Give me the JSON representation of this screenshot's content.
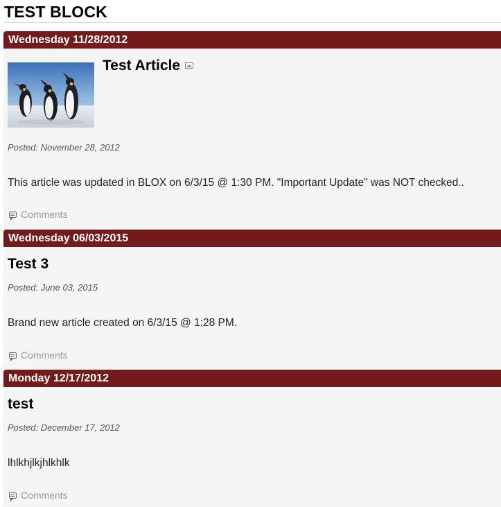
{
  "block": {
    "title": "TEST BLOCK"
  },
  "articles": [
    {
      "date": "Wednesday 11/28/2012",
      "title": "Test Article",
      "has_image": true,
      "image_icon": "image-icon",
      "posted": "Posted: November 28, 2012",
      "body": "This article was updated in BLOX on 6/3/15 @ 1:30 PM. \"Important Update\" was NOT checked..",
      "comments_label": "Comments"
    },
    {
      "date": "Wednesday 06/03/2015",
      "title": "Test 3",
      "has_image": false,
      "posted": "Posted: June 03, 2015",
      "body": "Brand new article created on 6/3/15 @ 1:28 PM.",
      "comments_label": "Comments"
    },
    {
      "date": "Monday 12/17/2012",
      "title": "test",
      "has_image": false,
      "posted": "Posted: December 17, 2012",
      "body": "lhlkhjlkjhlkhlk",
      "comments_label": "Comments"
    }
  ],
  "colors": {
    "date_bar": "#741a1a",
    "article_bg": "#f5f5f5",
    "comments_text": "#9a9a9a"
  }
}
